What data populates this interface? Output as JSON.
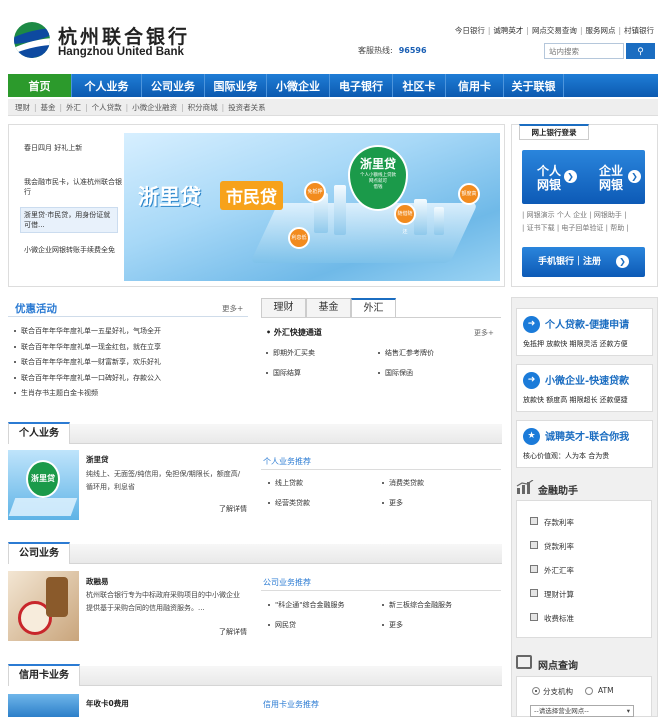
{
  "header": {
    "logo_cn": "杭州联合银行",
    "logo_en": "Hangzhou United Bank",
    "top_links": [
      "今日银行",
      "诚聘英才",
      "网点交易查询",
      "服务网点",
      "村镇银行"
    ],
    "hotline_label": "客服热线:",
    "hotline_number": "96596",
    "search_placeholder": "站内搜索",
    "search_icon": "search-icon"
  },
  "nav": {
    "items": [
      "首页",
      "个人业务",
      "公司业务",
      "国际业务",
      "小微企业",
      "电子银行",
      "社区卡",
      "信用卡",
      "关于联银"
    ],
    "active_index": 0
  },
  "subnav": [
    "理财",
    "基金",
    "外汇",
    "个人贷款",
    "小微企业融资",
    "积分商城",
    "投资者关系"
  ],
  "news": [
    "春日四月 好礼上新",
    "我会融市民卡，认准杭州联合银行",
    "浙里贷·市民贷，用身份证就可借...",
    "小微企业网银转账手续费全免"
  ],
  "banner": {
    "brand": "浙里贷",
    "tag": "市民贷",
    "pin_title": "浙里贷",
    "pin_sub": "个人小额线上贷款",
    "pin_lines": [
      "网点就可",
      "借钱"
    ],
    "orange_pins": [
      "免抵押",
      "随借随还",
      "利息低",
      "额度高"
    ]
  },
  "login": {
    "tab": "网上银行登录",
    "personal": [
      "个人",
      "网银"
    ],
    "corporate": [
      "企业",
      "网银"
    ],
    "links_row1": [
      "网银演示",
      "个人",
      "企业",
      "网银助手"
    ],
    "links_row2": [
      "证书下载",
      "电子回单验证",
      "帮助"
    ],
    "mobile": "手机银行｜注册"
  },
  "promo": {
    "title": "优惠活动",
    "more": "更多+",
    "items": [
      "联合百年年华年度礼单一五星好礼，气场全开",
      "联合百年年华年度礼单一现金红包，就在立享",
      "联合百年年华年度礼单一财富新享，欢乐好礼",
      "联合百年年华年度礼单一口碑好礼，存款公入",
      "生肖存书主题白金卡视频"
    ]
  },
  "fx": {
    "tabs": [
      "理财",
      "基金",
      "外汇"
    ],
    "active_tab": 2,
    "title": "外汇快捷通道",
    "more": "更多+",
    "items": [
      "即期外汇买卖",
      "结售汇参考牌价",
      "国际结算",
      "国际保函"
    ]
  },
  "sections": {
    "personal": {
      "title": "个人业务",
      "product_name": "浙里贷",
      "desc": "纯线上、无面签/纯信用，免担保/期限长，额度高/循环用，利息省",
      "more": "了解详情",
      "rec_title": "个人业务推荐",
      "rec_items": [
        "线上贷款",
        "消费类贷款",
        "经营类贷款",
        "更多"
      ],
      "img_text": "浙里贷"
    },
    "corporate": {
      "title": "公司业务",
      "product_name": "政融易",
      "desc": "杭州联合银行专为中标政府采购项目的中小微企业提供基于采购合同的信用融资服务。...",
      "more": "了解详情",
      "rec_title": "公司业务推荐",
      "rec_items": [
        "\"科企通\"综合金融服务",
        "新三板综合金融服务",
        "网民贷",
        "更多"
      ]
    },
    "credit": {
      "title": "信用卡业务",
      "product_name": "年收卡0费用",
      "rec_title": "信用卡业务推荐"
    }
  },
  "side": {
    "cards": [
      {
        "title": "个人贷款-便捷申请",
        "sub": "免抵押 放款快 期限灵活 还款方便",
        "icon": "arrow-right-icon"
      },
      {
        "title": "小微企业-快速贷款",
        "sub": "放款快 额度高 期限超长 还款便捷",
        "icon": "arrow-right-icon"
      },
      {
        "title": "诚聘英才-联合你我",
        "sub": "核心价值观：人为本 合为贵",
        "icon": "star-icon"
      }
    ],
    "finance_title": "金融助手",
    "finance_items": [
      "存款利率",
      "贷款利率",
      "外汇汇率",
      "理财计算",
      "收费标准"
    ],
    "outlet_title": "网点查询",
    "outlet_radio": [
      "分支机构",
      "ATM"
    ],
    "outlet_select": "--请选择营业网点--"
  },
  "colors": {
    "brand_blue": "#1b6dc1",
    "nav_active": "#2c9a2c",
    "logo_green": "#1d8a45"
  }
}
